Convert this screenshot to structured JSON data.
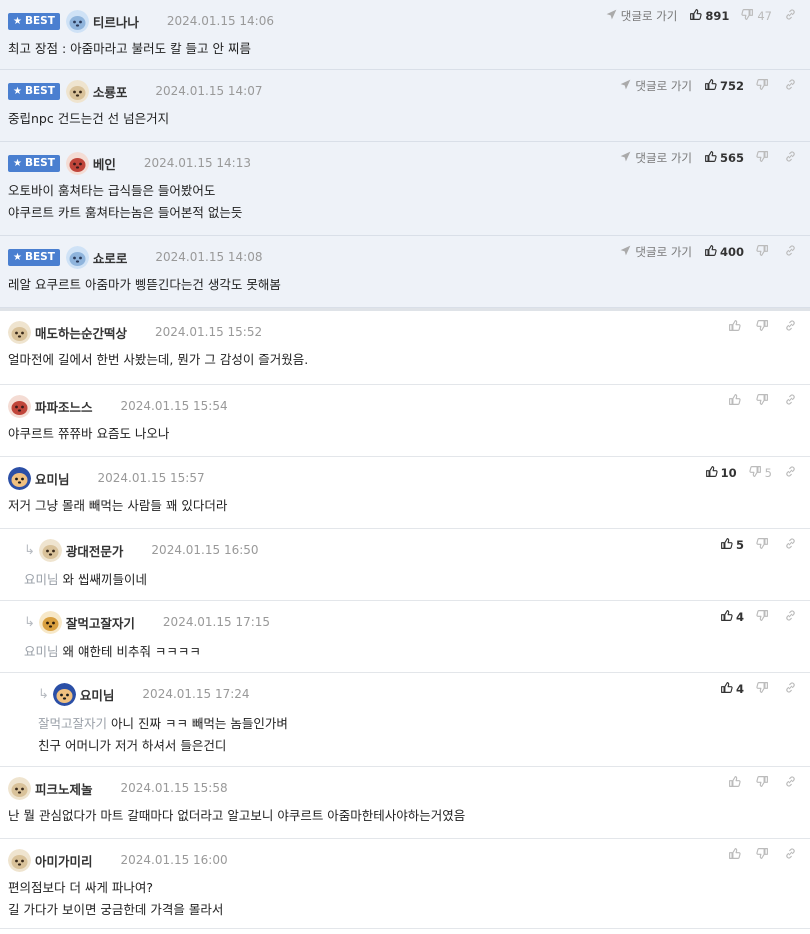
{
  "labels": {
    "best": "BEST",
    "reply": "댓글로 가기"
  },
  "colors": {
    "best_bg": "#eef2f8",
    "badge": "#4a7fd0",
    "muted": "#9aa0a8"
  },
  "comments": [
    {
      "best": true,
      "nick": "티르나나",
      "date": "2024.01.15 14:06",
      "text": "최고 장점 : 아줌마라고 불러도 칼 들고 안 찌름",
      "likes": "891",
      "dislikes": "47",
      "avatar": "blue-dog"
    },
    {
      "best": true,
      "nick": "소룡포",
      "date": "2024.01.15 14:07",
      "text": "중립npc 건드는건 선 넘은거지",
      "likes": "752",
      "dislikes": "",
      "avatar": "puppy"
    },
    {
      "best": true,
      "nick": "베인",
      "date": "2024.01.15 14:13",
      "text": "오토바이 훔쳐타는 급식들은 들어봤어도\n야쿠르트 카트 훔쳐타는놈은 들어본적 없는듯",
      "likes": "565",
      "dislikes": "",
      "avatar": "red-dog"
    },
    {
      "best": true,
      "nick": "쇼로로",
      "date": "2024.01.15 14:08",
      "text": "레알 요쿠르트 아줌마가 삥뜯긴다는건 생각도 못해봄",
      "likes": "400",
      "dislikes": "",
      "avatar": "blue-dog"
    },
    {
      "best": false,
      "nick": "매도하는순간떡상",
      "date": "2024.01.15 15:52",
      "text": "얼마전에 길에서 한번 사봤는데, 뭔가 그 감성이 즐거웠음.",
      "likes": "",
      "dislikes": "",
      "avatar": "puppy"
    },
    {
      "best": false,
      "nick": "파파조느스",
      "date": "2024.01.15 15:54",
      "text": "야쿠르트 쮸쮸바 요즘도 나오나",
      "likes": "",
      "dislikes": "",
      "avatar": "red-dog"
    },
    {
      "best": false,
      "nick": "요미님",
      "date": "2024.01.15 15:57",
      "text": "저거 그냥 몰래 빼먹는 사람들 꽤 있다더라",
      "likes": "10",
      "dislikes": "5",
      "avatar": "fox-blue"
    },
    {
      "best": false,
      "depth": 1,
      "nick": "광대전문가",
      "date": "2024.01.15 16:50",
      "mention": "요미님",
      "text": "와 씹쌔끼들이네",
      "likes": "5",
      "dislikes": "",
      "avatar": "puppy"
    },
    {
      "best": false,
      "depth": 1,
      "nick": "잘먹고잘자기",
      "date": "2024.01.15 17:15",
      "mention": "요미님",
      "text": "왜 얘한테 비추줘 ㅋㅋㅋㅋ",
      "likes": "4",
      "dislikes": "",
      "avatar": "fox"
    },
    {
      "best": false,
      "depth": 2,
      "nick": "요미님",
      "date": "2024.01.15 17:24",
      "mention": "잘먹고잘자기",
      "text": "아니 진짜 ㅋㅋ 빼먹는 놈들인가벼\n친구 어머니가 저거 하셔서 들은건디",
      "likes": "4",
      "dislikes": "",
      "avatar": "fox-blue"
    },
    {
      "best": false,
      "nick": "피크노제놀",
      "date": "2024.01.15 15:58",
      "text": "난 뭘 관심없다가 마트 갈때마다 없더라고 알고보니 야쿠르트 아줌마한테사야하는거였음",
      "likes": "",
      "dislikes": "",
      "avatar": "puppy"
    },
    {
      "best": false,
      "nick": "아미가미리",
      "date": "2024.01.15 16:00",
      "text": "편의점보다 더 싸게 파나여?\n길 가다가 보이면 궁금한데 가격을 몰라서",
      "likes": "",
      "dislikes": "",
      "avatar": "puppy"
    }
  ]
}
